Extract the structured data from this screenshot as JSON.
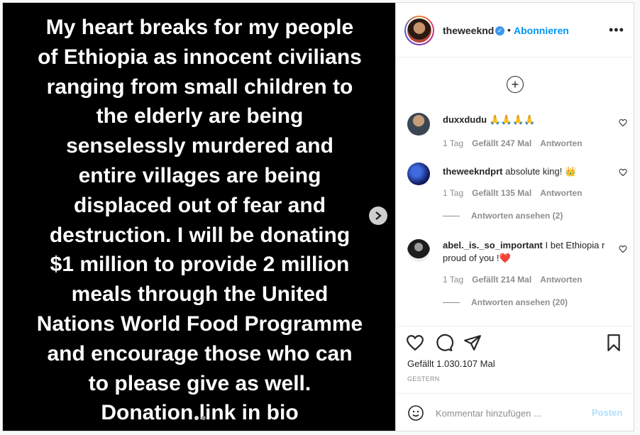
{
  "post": {
    "lines": [
      "My heart breaks for my people",
      "of Ethiopia as innocent civilians",
      "ranging from small children to",
      "the elderly are being",
      "senselessly murdered and",
      "entire villages are being",
      "displaced out of fear and",
      "destruction. I will be donating",
      "$1 million to provide 2 million",
      "meals through the United",
      "Nations World Food Programme",
      "and encourage those who can",
      "to please give as well.",
      "Donation link in bio"
    ],
    "next_icon": "chevron-right-icon"
  },
  "header": {
    "username": "theweeknd",
    "verified_icon": "verified-badge-icon",
    "separator": "•",
    "follow_label": "Abonnieren",
    "more_label": "•••"
  },
  "comments": {
    "load_more_icon": "plus-circle-icon",
    "items": [
      {
        "user": "duxxdudu",
        "text": "🙏🙏🙏🙏",
        "time": "1 Tag",
        "likes": "Gefällt 247 Mal",
        "reply": "Antworten",
        "avatar_color": "#5a6b7c"
      },
      {
        "user": "theweekndprt",
        "text": "absolute king! 👑",
        "time": "1 Tag",
        "likes": "Gefällt 135 Mal",
        "reply": "Antworten",
        "view_replies": "Antworten ansehen (2)",
        "avatar_color": "#1c2a8a"
      },
      {
        "user": "abel._is._so_important",
        "text": "I bet Ethiopia r proud of you !❤️",
        "time": "1 Tag",
        "likes": "Gefällt 214 Mal",
        "reply": "Antworten",
        "view_replies": "Antworten ansehen (20)",
        "avatar_color": "#333333"
      }
    ]
  },
  "actions": {
    "likes": "Gefällt 1.030.107 Mal",
    "date": "GESTERN",
    "comment_placeholder": "Kommentar hinzufügen ...",
    "post_label": "Posten"
  },
  "colors": {
    "accent": "#0095f6",
    "post_disabled": "#b2dffc",
    "heart_red": "#ed4956"
  }
}
